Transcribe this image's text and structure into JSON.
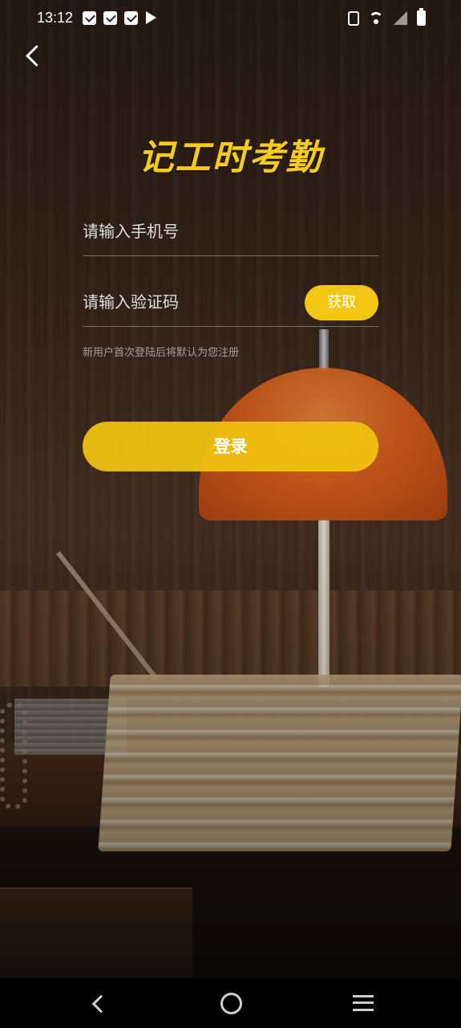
{
  "status_bar": {
    "time": "13:12",
    "notification_icons": [
      "message-icon",
      "message-icon",
      "message-icon",
      "play-store-icon"
    ],
    "system_icons": [
      "vibrate-icon",
      "wifi-icon",
      "signal-icon",
      "battery-icon"
    ]
  },
  "header": {
    "back_icon": "chevron-left-icon"
  },
  "app": {
    "title": "记工时考勤",
    "accent_color": "#f3c613"
  },
  "form": {
    "phone_placeholder": "请输入手机号",
    "phone_value": "",
    "code_placeholder": "请输入验证码",
    "code_value": "",
    "get_code_label": "获取",
    "hint": "新用户首次登陆后将默认为您注册",
    "login_label": "登录"
  },
  "nav_bar": {
    "icons": [
      "back-nav-icon",
      "home-nav-icon",
      "menu-nav-icon"
    ]
  }
}
